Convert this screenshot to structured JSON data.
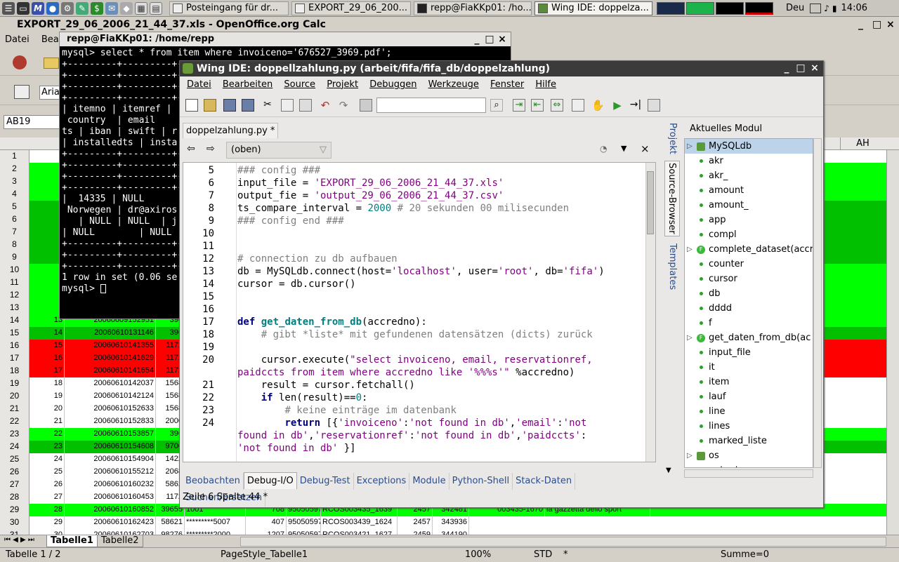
{
  "taskbar": {
    "tasks": [
      {
        "label": "Posteingang für dr..."
      },
      {
        "label": "EXPORT_29_06_200..."
      },
      {
        "label": "repp@FiaKKp01: /ho..."
      },
      {
        "label": "Wing IDE: doppelza..."
      }
    ],
    "keyboard": "Deu",
    "clock": "14:06"
  },
  "calc": {
    "title": "EXPORT_29_06_2006_21_44_37.xls - OpenOffice.org Calc",
    "menu": [
      "Datei",
      "Bearbe"
    ],
    "font_name": "Aria",
    "cell_ref": "AB19",
    "col_header_right": "AH",
    "rows": [
      {
        "n": "1",
        "color": "#ffffff",
        "cells": []
      },
      {
        "n": "2",
        "color": "#00ff00",
        "cells": []
      },
      {
        "n": "3",
        "color": "#00ff00",
        "cells": []
      },
      {
        "n": "4",
        "color": "#00ff00",
        "cells": []
      },
      {
        "n": "5",
        "color": "#00c000",
        "cells": []
      },
      {
        "n": "6",
        "color": "#00c000",
        "cells": []
      },
      {
        "n": "7",
        "color": "#00c000",
        "cells": []
      },
      {
        "n": "8",
        "color": "#00c000",
        "cells": []
      },
      {
        "n": "9",
        "color": "#00c000",
        "cells": []
      },
      {
        "n": "10",
        "color": "#00ff00",
        "cells": []
      },
      {
        "n": "11",
        "color": "#00ff00",
        "cells": []
      },
      {
        "n": "12",
        "color": "#00ff00",
        "cells": []
      },
      {
        "n": "13",
        "color": "#00ff00",
        "cells": []
      },
      {
        "n": "14",
        "color": "#00ff00",
        "cells": [
          "13",
          "20060609152951",
          "396"
        ]
      },
      {
        "n": "15",
        "color": "#00c000",
        "cells": [
          "14",
          "20060610131146",
          "396"
        ]
      },
      {
        "n": "16",
        "color": "#ff0000",
        "cells": [
          "15",
          "20060610141355",
          "1172"
        ]
      },
      {
        "n": "17",
        "color": "#ff0000",
        "cells": [
          "16",
          "20060610141629",
          "1172"
        ]
      },
      {
        "n": "18",
        "color": "#ff0000",
        "cells": [
          "17",
          "20060610141654",
          "1172"
        ]
      },
      {
        "n": "19",
        "color": "#ffffff",
        "cells": [
          "18",
          "20060610142037",
          "1568"
        ]
      },
      {
        "n": "20",
        "color": "#ffffff",
        "cells": [
          "19",
          "20060610142124",
          "1568"
        ]
      },
      {
        "n": "21",
        "color": "#ffffff",
        "cells": [
          "20",
          "20060610152633",
          "1568"
        ]
      },
      {
        "n": "22",
        "color": "#ffffff",
        "cells": [
          "21",
          "20060610152833",
          "2000"
        ]
      },
      {
        "n": "23",
        "color": "#00ff00",
        "cells": [
          "22",
          "20060610153857",
          "396"
        ]
      },
      {
        "n": "24",
        "color": "#00c000",
        "cells": [
          "23",
          "20060610154608",
          "9700"
        ]
      },
      {
        "n": "25",
        "color": "#ffffff",
        "cells": [
          "24",
          "20060610154904",
          "1422"
        ]
      },
      {
        "n": "26",
        "color": "#ffffff",
        "cells": [
          "25",
          "20060610155212",
          "2068"
        ]
      },
      {
        "n": "27",
        "color": "#ffffff",
        "cells": [
          "26",
          "20060610160232",
          "5862"
        ]
      },
      {
        "n": "28",
        "color": "#ffffff",
        "cells": [
          "27",
          "20060610160453",
          "1172"
        ]
      },
      {
        "n": "29",
        "color": "#00ff00",
        "cells": [
          "28",
          "20060610160852",
          "39655",
          "1001",
          "708",
          "9505059717",
          "RCOS003435_1639",
          "2457",
          "342481",
          "003435-1670",
          "la gazzetta dello sport"
        ]
      },
      {
        "n": "30",
        "color": "#ffffff",
        "cells": [
          "29",
          "20060610162423",
          "58621",
          "*********5007",
          "407",
          "9505059717",
          "RCOS003439_1624",
          "2457",
          "343936"
        ]
      },
      {
        "n": "31",
        "color": "#ffffff",
        "cells": [
          "30",
          "20060610162703",
          "98276",
          "*********2000",
          "1207",
          "9505059717",
          "RCOS003421_1627",
          "2459",
          "344190"
        ]
      }
    ],
    "sheet_tabs": [
      "Tabelle1",
      "Tabelle2"
    ],
    "status": {
      "sheet": "Tabelle 1 / 2",
      "page_style": "PageStyle_Tabelle1",
      "zoom": "100%",
      "mode": "STD",
      "modified": "*",
      "sum": "Summe=0"
    }
  },
  "terminal": {
    "title": "repp@FiaKKp01: /home/repp",
    "lines": [
      "mysql> select * from item where invoiceno='676527_3969.pdf';",
      "+---------+---------+--",
      "+---------+---------+--",
      "+---------+---------+--",
      "+---------+---------+--",
      "| itemno | itemref |",
      " country  | email",
      "ts | iban | swift | r",
      "| installedts | insta",
      "+---------+---------+--",
      "+---------+---------+--",
      "+---------+---------+--",
      "+---------+---------+--",
      "|  14335 | NULL",
      " Norwegen | dr@axiros",
      "   | NULL | NULL  | j",
      "| NULL        | NULL",
      "+---------+---------+--",
      "+---------+---------+--",
      "+---------+---------+--",
      "1 row in set (0.06 se",
      "",
      "mysql> "
    ]
  },
  "wing": {
    "title": "Wing IDE: doppellzahlung.py (arbeit/fifa/fifa_db/doppelzahlung)",
    "menu": [
      "Datei",
      "Bearbeiten",
      "Source",
      "Projekt",
      "Debuggen",
      "Werkzeuge",
      "Fenster",
      "Hilfe"
    ],
    "editor_tab": "doppelzahlung.py *",
    "scope": "(oben)",
    "code_lines": [
      {
        "n": "5",
        "html": "<span class='cm'>### config ###</span>"
      },
      {
        "n": "6",
        "html": "input_file = <span class='st'>'EXPORT_29_06_2006_21_44_37.xls'</span>"
      },
      {
        "n": "7",
        "html": "output_fie = <span class='st'>'output_29_06_2006_21_44_37.csv'</span>"
      },
      {
        "n": "8",
        "html": "ts_compare_interval = <span class='nm'>2000</span> <span class='cm'># 20 sekunden 00 milisecunden</span>"
      },
      {
        "n": "9",
        "html": "<span class='cm'>### config end ###</span>"
      },
      {
        "n": "10",
        "html": ""
      },
      {
        "n": "11",
        "html": ""
      },
      {
        "n": "12",
        "html": "<span class='cm'># connection zu db aufbauen</span>"
      },
      {
        "n": "13",
        "html": "db = MySQLdb.connect(host=<span class='st'>'localhost'</span>, user=<span class='st'>'root'</span>, db=<span class='st'>'fifa'</span>)"
      },
      {
        "n": "14",
        "html": "cursor = db.cursor()"
      },
      {
        "n": "15",
        "html": ""
      },
      {
        "n": "16",
        "html": ""
      },
      {
        "n": "17",
        "html": "<span class='kw'>def</span> <span class='fn'>get_daten_from_db</span>(accredno):"
      },
      {
        "n": "18",
        "html": "    <span class='cm'># gibt *liste* mit gefundenen datensätzen (dicts) zurück</span>"
      },
      {
        "n": "19",
        "html": ""
      },
      {
        "n": "20",
        "html": "    cursor.execute(<span class='st'>\"select invoiceno, email, reservationref,</span>"
      },
      {
        "n": "",
        "html": "<span class='st'>paidccts from item where accredno like '%%%s'\"</span> %accredno)"
      },
      {
        "n": "21",
        "html": "    result = cursor.fetchall()"
      },
      {
        "n": "22",
        "html": "    <span class='kw'>if</span> len(result)==<span class='nm'>0</span>:"
      },
      {
        "n": "23",
        "html": "        <span class='cm'># keine einträge im datenbank</span>"
      },
      {
        "n": "24",
        "html": "        <span class='kw'>return</span> [{<span class='st'>'invoiceno'</span>:<span class='st'>'not found in db'</span>,<span class='st'>'email'</span>:<span class='st'>'not</span>"
      },
      {
        "n": "",
        "html": "<span class='st'>found in db'</span>,<span class='st'>'reservationref'</span>:<span class='st'>'not found in db'</span>,<span class='st'>'paidccts'</span>:"
      },
      {
        "n": "",
        "html": "<span class='st'>'not found in db'</span> }]"
      },
      {
        "n": "",
        "html": ""
      },
      {
        "n": "25",
        "html": ""
      }
    ],
    "side_tabs": [
      "Projekt",
      "Source-Browser",
      "Templates"
    ],
    "browser_header": "Aktuelles Modul durchsuchen",
    "browser_items": [
      {
        "label": "MySQLdb",
        "kind": "module",
        "expand": true
      },
      {
        "label": "akr",
        "kind": "var"
      },
      {
        "label": "akr_",
        "kind": "var"
      },
      {
        "label": "amount",
        "kind": "var"
      },
      {
        "label": "amount_",
        "kind": "var"
      },
      {
        "label": "app",
        "kind": "var"
      },
      {
        "label": "compl",
        "kind": "var"
      },
      {
        "label": "complete_dataset(accr",
        "kind": "func",
        "expand": true
      },
      {
        "label": "counter",
        "kind": "var"
      },
      {
        "label": "cursor",
        "kind": "var"
      },
      {
        "label": "db",
        "kind": "var"
      },
      {
        "label": "dddd",
        "kind": "var"
      },
      {
        "label": "f",
        "kind": "var"
      },
      {
        "label": "get_daten_from_db(ac",
        "kind": "func",
        "expand": true
      },
      {
        "label": "input_file",
        "kind": "var"
      },
      {
        "label": "it",
        "kind": "var"
      },
      {
        "label": "item",
        "kind": "var"
      },
      {
        "label": "lauf",
        "kind": "var"
      },
      {
        "label": "line",
        "kind": "var"
      },
      {
        "label": "lines",
        "kind": "var"
      },
      {
        "label": "marked_liste",
        "kind": "var"
      },
      {
        "label": "os",
        "kind": "module",
        "expand": true
      },
      {
        "label": "output",
        "kind": "var"
      }
    ],
    "bottom_tabs": [
      "Beobachten",
      "Debug-I/O",
      "Debug-Test",
      "Exceptions",
      "Module",
      "Python-Shell",
      "Stack-Daten",
      "Suchen/Ersetzen"
    ],
    "active_bottom_tab": "Debug-I/O",
    "status": "Zeile 6 Spalte 44 *"
  }
}
